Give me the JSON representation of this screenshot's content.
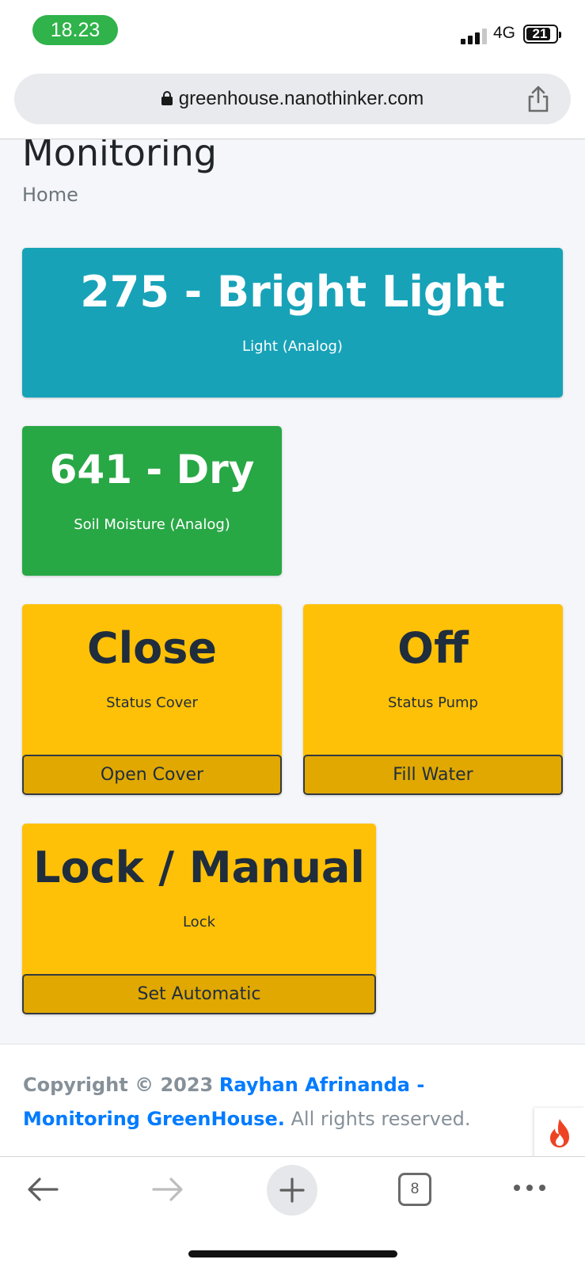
{
  "status_bar": {
    "time": "18.23",
    "network": "4G",
    "battery": "21"
  },
  "browser": {
    "url": "greenhouse.nanothinker.com",
    "tab_count": "8"
  },
  "page": {
    "title": "Monitoring",
    "breadcrumb": "Home"
  },
  "cards": {
    "light": {
      "value": "275 - Bright Light",
      "label": "Light (Analog)",
      "color": "#17a2b8"
    },
    "soil": {
      "value": "641 - Dry",
      "label": "Soil Moisture (Analog)",
      "color": "#28a745"
    },
    "cover": {
      "value": "Close",
      "label": "Status Cover",
      "button": "Open Cover",
      "color": "#ffc107"
    },
    "pump": {
      "value": "Off",
      "label": "Status Pump",
      "button": "Fill Water",
      "color": "#ffc107"
    },
    "mode": {
      "value": "Lock / Manual",
      "label": "Lock",
      "button": "Set Automatic",
      "color": "#ffc107"
    }
  },
  "footer": {
    "copyright": "Copyright © 2023",
    "link": "Rayhan Afrinanda - Monitoring GreenHouse.",
    "rights": "All rights reserved."
  },
  "icons": {
    "lock": "lock-icon",
    "share": "share-icon",
    "flame": "flame-icon",
    "back": "back-arrow-icon",
    "forward": "forward-arrow-icon",
    "plus": "plus-icon",
    "more": "more-icon"
  }
}
